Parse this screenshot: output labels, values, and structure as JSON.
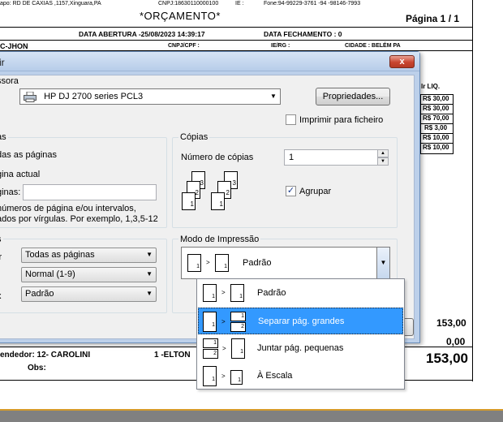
{
  "report": {
    "header_left": "apo:  RD DE CAXIAS ,1157,Xinguara,PA",
    "header_cnpj": "CNPJ:18630110000100",
    "header_ie": "IE :",
    "header_phone": "Fone:94-99229-3761 -94 -98146-7993",
    "doc_title": "*ORÇAMENTO*",
    "page_label": "Página 1 / 1",
    "opening_date": "DATA ABERTURA  -25/08/2023 14:39:17",
    "closing_date": "DATA FECHAMENTO : 0",
    "client_name": "C-JHON",
    "cnpj_label": "CNPJ/CPF :",
    "ie_rg_label": "IE/RG :",
    "city_label": "CIDADE : BELÉM PA",
    "col_header": "lr LIQ.",
    "values": [
      "R$ 30,00",
      "R$ 30,00",
      "R$ 70,00",
      "R$ 3,00",
      "R$ 10,00",
      "R$ 10,00"
    ],
    "total_1": "153,00",
    "total_2": "0,00",
    "total_big": "153,00",
    "seller": "endedor: 12- CAROLINI",
    "seller_2": "1 -ELTON",
    "obs_label": "Obs:"
  },
  "dialog": {
    "title": "ir",
    "close_label": "x",
    "printer_group": "ssora",
    "printer_name": "HP DJ 2700 series PCL3",
    "properties_button": "Propriedades...",
    "print_to_file": "Imprimir para ficheiro",
    "pages_group": "as",
    "all_pages": "das as páginas",
    "current_page": "gina actual",
    "pages_label": "ginas:",
    "pages_hint_1": "números de página e/ou intervalos,",
    "pages_hint_2": "ados por vírgulas. Por exemplo, 1,3,5-12",
    "copies_group": "Cópias",
    "copies_label": "Número de cópias",
    "copies_value": "1",
    "collate_label": "Agrupar",
    "options_group": "s",
    "opt_label_1": "ir",
    "opt_value_1": "Todas as páginas",
    "opt_value_2": "Normal (1-9)",
    "opt_label_3": "x",
    "opt_value_3": "Padrão",
    "mode_group": "Modo de Impressão",
    "mode_selected": "Padrão",
    "mode_options": [
      "Padrão",
      "Separar pág. grandes",
      "Juntar pág. pequenas",
      "À Escala"
    ]
  },
  "colors": {
    "selection": "#3399ff",
    "close_button": "#c94530",
    "dialog_frame": "#bcd0ea"
  }
}
